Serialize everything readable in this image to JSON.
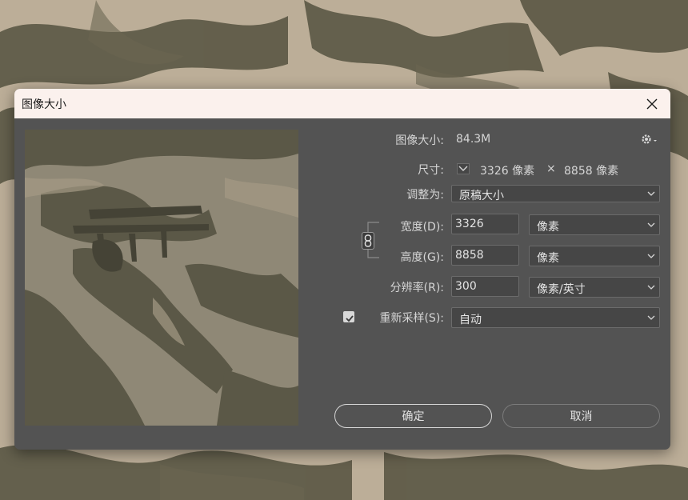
{
  "dialog": {
    "title": "图像大小",
    "close_icon": "close-icon"
  },
  "info": {
    "image_size_label": "图像大小:",
    "image_size_value": "84.3M",
    "dimensions_label": "尺寸:",
    "dimensions_width": "3326 像素",
    "dimensions_times": "×",
    "dimensions_height": "8858 像素"
  },
  "fit_to": {
    "label": "调整为:",
    "value": "原稿大小"
  },
  "width": {
    "label": "宽度(D):",
    "value": "3326",
    "unit": "像素"
  },
  "height": {
    "label": "高度(G):",
    "value": "8858",
    "unit": "像素"
  },
  "resolution": {
    "label": "分辨率(R):",
    "value": "300",
    "unit": "像素/英寸"
  },
  "resample": {
    "label": "重新采样(S):",
    "checked": true,
    "value": "自动"
  },
  "buttons": {
    "ok": "确定",
    "cancel": "取消"
  },
  "colors": {
    "dialog_bg": "#535353",
    "titlebar_bg": "#fbf1ed",
    "field_bg": "#464646",
    "text": "#d6d6d6",
    "paper": "#b9ab96",
    "ink": "#4e4c3e"
  }
}
